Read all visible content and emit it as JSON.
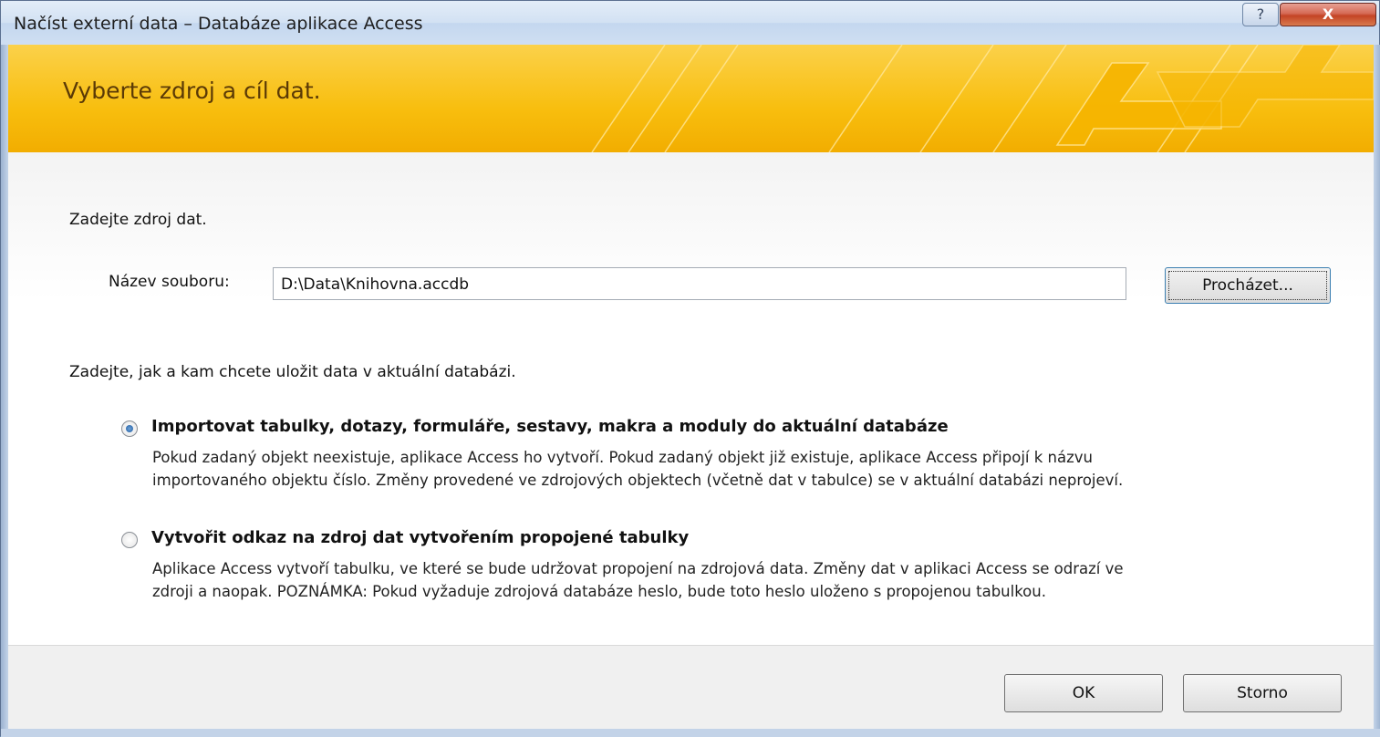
{
  "window": {
    "title": "Načíst externí data – Databáze aplikace Access",
    "help_glyph": "?",
    "close_glyph": "X"
  },
  "banner": {
    "heading": "Vyberte zdroj a cíl dat."
  },
  "source": {
    "instruction": "Zadejte zdroj dat.",
    "filename_label": "Název souboru:",
    "filename_value": "D:\\Data\\Knihovna.accdb",
    "browse_label": "Procházet..."
  },
  "destination": {
    "instruction": "Zadejte, jak a kam chcete uložit data v aktuální databázi.",
    "options": [
      {
        "title": "Importovat tabulky, dotazy, formuláře, sestavy, makra a moduly do aktuální databáze",
        "desc_line1": "Pokud zadaný objekt neexistuje, aplikace Access ho vytvoří. Pokud zadaný objekt již existuje, aplikace Access připojí k názvu",
        "desc_line2": "importovaného objektu číslo. Změny provedené ve zdrojových objektech (včetně dat v tabulce) se v aktuální databázi neprojeví.",
        "selected": true
      },
      {
        "title": "Vytvořit odkaz na zdroj dat vytvořením propojené tabulky",
        "desc_line1": "Aplikace Access vytvoří tabulku, ve které se bude udržovat propojení na zdrojová data. Změny dat v aplikaci Access se odrazí ve",
        "desc_line2": "zdroji a naopak. POZNÁMKA: Pokud vyžaduje zdrojová databáze heslo, bude toto heslo uloženo s propojenou tabulkou.",
        "selected": false
      }
    ]
  },
  "footer": {
    "ok_label": "OK",
    "cancel_label": "Storno"
  },
  "colors": {
    "banner": "#f8be0e",
    "banner_text": "#5b3a06",
    "close_button": "#c44325",
    "focus_border": "#3c7fb1"
  }
}
